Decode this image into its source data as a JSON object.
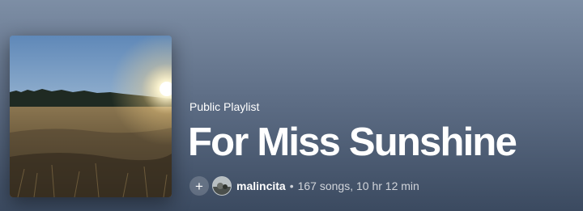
{
  "playlist": {
    "type_label": "Public Playlist",
    "title": "For Miss Sunshine",
    "owner": "malincita",
    "separator": "•",
    "stats": "167 songs, 10 hr 12 min",
    "add_icon": "plus-icon",
    "cover_description_icon": "sunset-field-cover"
  },
  "colors": {
    "header_top": "#7d8ea5",
    "header_bottom": "#3b4a60",
    "text_primary": "#ffffff"
  }
}
